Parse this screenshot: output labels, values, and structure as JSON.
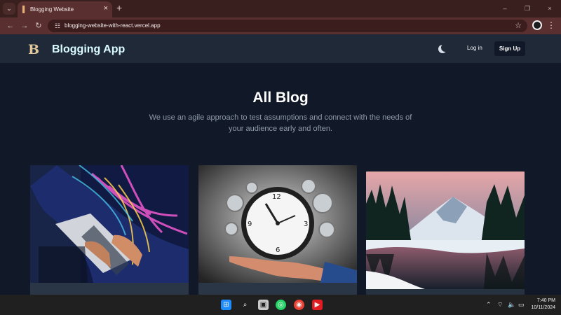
{
  "browser": {
    "tab_title": "Blogging Website",
    "url": "blogging-website-with-react.vercel.app",
    "window": {
      "minimize": "–",
      "restore": "❐",
      "close": "×"
    }
  },
  "site": {
    "brand": "Blogging App",
    "logo_letter": "B",
    "login": "Log in",
    "signup": "Sign Up"
  },
  "main": {
    "title": "All Blog",
    "intro": "We use an agile approach to test assumptions and connect with the needs of your audience early and often."
  },
  "cards": [
    {
      "image": "laptop-hands-image"
    },
    {
      "image": "clock-gears-hand-image"
    },
    {
      "image": "snow-mountain-lake-image"
    }
  ],
  "taskbar": {
    "time": "7:40 PM",
    "date": "10/11/2024"
  },
  "colors": {
    "page_background": "#111827",
    "header": "#1f2937",
    "brand_text": "#d9fbff",
    "browser_frame": "#5a2f2f"
  },
  "icons": [
    "tab-list-icon",
    "site-favicon",
    "close-tab-icon",
    "new-tab-icon",
    "back-icon",
    "forward-icon",
    "reload-icon",
    "site-info-icon",
    "bookmark-icon",
    "profile-icon",
    "menu-icon",
    "theme-toggle-icon",
    "windows-start-icon",
    "search-icon",
    "task-view-icon",
    "whatsapp-icon",
    "chrome-icon",
    "youtube-icon",
    "show-hidden-icons-icon",
    "wifi-icon",
    "volume-icon",
    "battery-icon"
  ]
}
